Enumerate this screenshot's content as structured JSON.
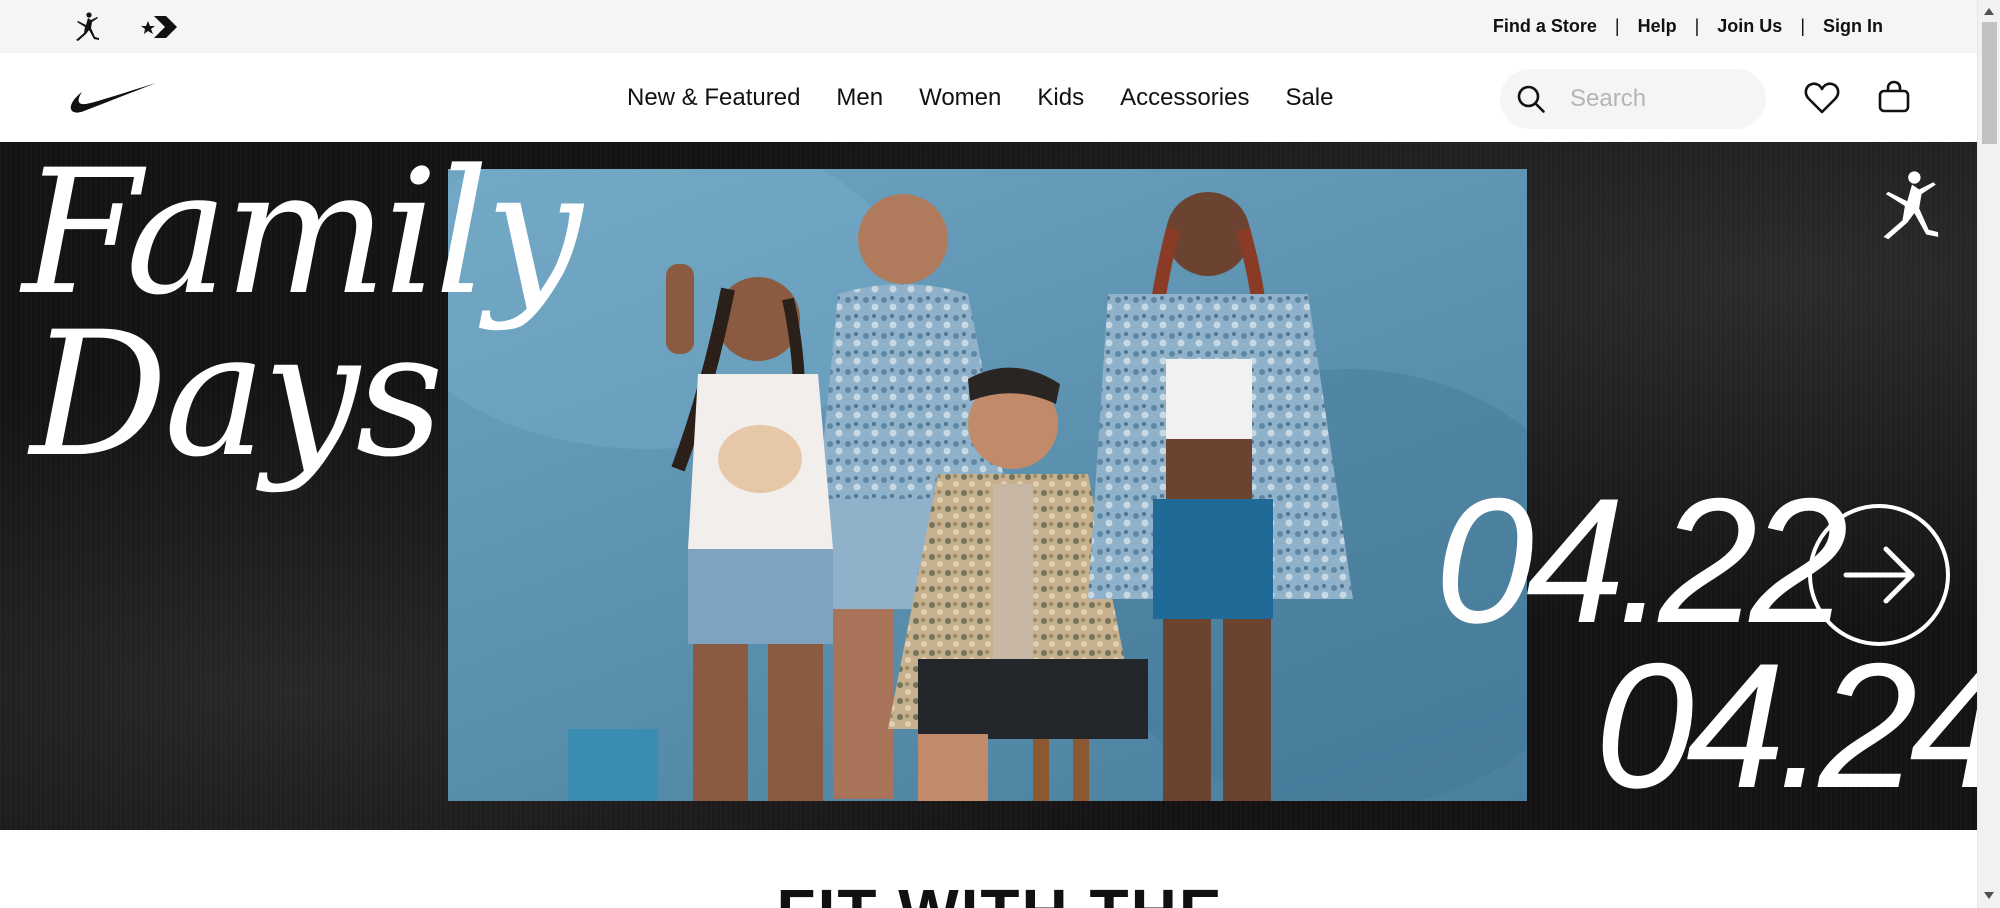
{
  "utility_bar": {
    "brands": [
      "jordan-icon",
      "converse-icon"
    ],
    "links": [
      "Find a Store",
      "Help",
      "Join Us",
      "Sign In"
    ],
    "separator": "|"
  },
  "nav": {
    "logo": "nike-swoosh-icon",
    "menu": [
      "New & Featured",
      "Men",
      "Women",
      "Kids",
      "Accessories",
      "Sale"
    ],
    "search": {
      "placeholder": "Search",
      "value": ""
    },
    "icons": [
      "search-icon",
      "heart-icon",
      "bag-icon"
    ]
  },
  "hero": {
    "title_line1": "Family",
    "title_line2": "Days",
    "date_start": "04.22",
    "date_end": "04.24",
    "cta_icon": "arrow-right-icon",
    "brand_icon": "jordan-icon",
    "background_color": "#141212"
  },
  "section": {
    "heading": "FIT WITH THE"
  },
  "colors": {
    "utility_bg": "#f5f5f5",
    "text": "#111111",
    "search_bg": "#f5f5f5",
    "hero_text": "#ffffff"
  }
}
